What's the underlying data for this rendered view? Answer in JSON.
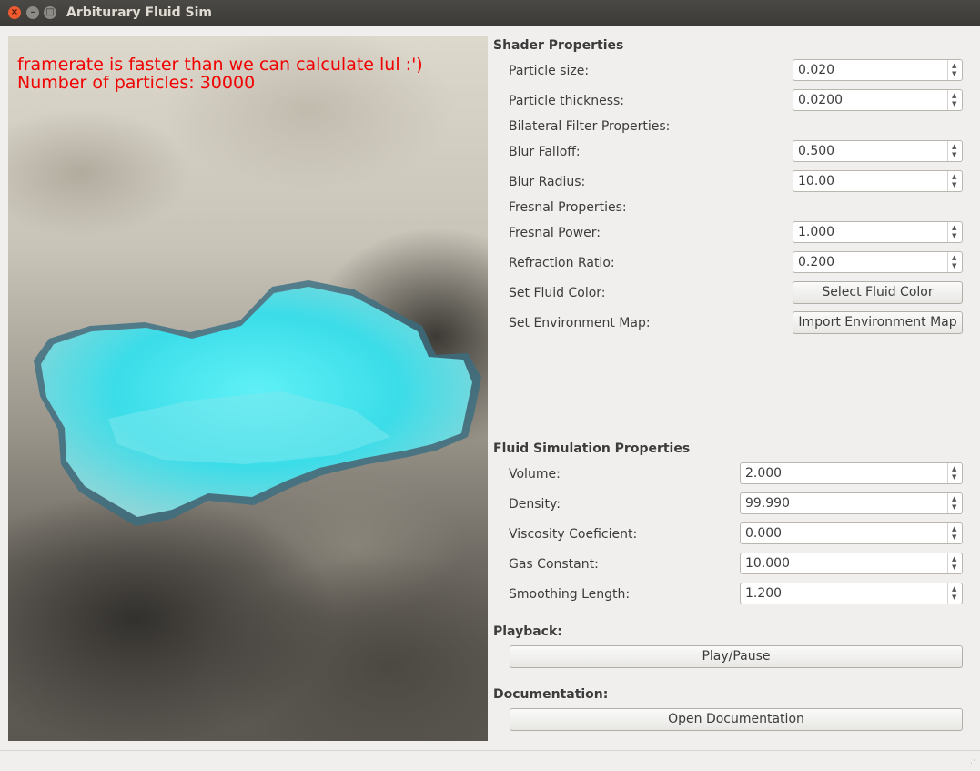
{
  "window": {
    "title": "Arbiturary Fluid Sim"
  },
  "viewport": {
    "overlay_line1": "framerate is faster than we can calculate lul :')",
    "overlay_line2": "Number of particles: 30000",
    "overlay_color": "#f00000"
  },
  "shader": {
    "heading": "Shader Properties",
    "particle_size_label": "Particle size:",
    "particle_size_value": "0.020",
    "particle_thickness_label": "Particle thickness:",
    "particle_thickness_value": "0.0200",
    "bilateral_heading": "Bilateral Filter Properties:",
    "blur_falloff_label": "Blur Falloff:",
    "blur_falloff_value": "0.500",
    "blur_radius_label": "Blur Radius:",
    "blur_radius_value": "10.00",
    "fresnal_heading": "Fresnal Properties:",
    "fresnal_power_label": "Fresnal Power:",
    "fresnal_power_value": "1.000",
    "refraction_ratio_label": "Refraction Ratio:",
    "refraction_ratio_value": "0.200",
    "fluid_color_label": "Set Fluid Color:",
    "fluid_color_button": "Select Fluid Color",
    "env_map_label": "Set Environment Map:",
    "env_map_button": "Import Environment Map"
  },
  "simulation": {
    "heading": "Fluid Simulation Properties",
    "volume_label": "Volume:",
    "volume_value": "2.000",
    "density_label": "Density:",
    "density_value": "99.990",
    "viscosity_label": "Viscosity Coeficient:",
    "viscosity_value": "0.000",
    "gas_label": "Gas Constant:",
    "gas_value": "10.000",
    "smoothing_label": "Smoothing Length:",
    "smoothing_value": "1.200"
  },
  "playback": {
    "heading": "Playback:",
    "button": "Play/Pause"
  },
  "documentation": {
    "heading": "Documentation:",
    "button": "Open Documentation"
  },
  "icons": {
    "close": "close-icon",
    "minimize": "minimize-icon",
    "maximize": "maximize-icon",
    "spin_up": "arrow-up-icon",
    "spin_down": "arrow-down-icon",
    "resize_grip": "resize-grip-icon"
  },
  "colors": {
    "fluid": "#3fe0ee",
    "titlebar": "#3b3a37",
    "panel_bg": "#f0efed"
  }
}
